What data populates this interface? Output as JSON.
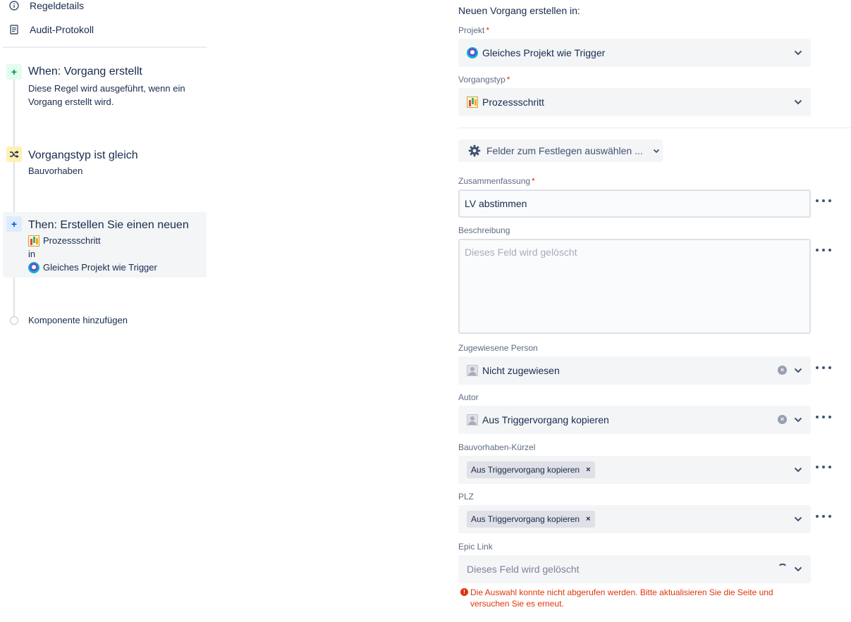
{
  "sidebar": {
    "nav": [
      {
        "label": "Regeldetails",
        "icon": "info-icon"
      },
      {
        "label": "Audit-Protokoll",
        "icon": "document-icon"
      }
    ],
    "steps": [
      {
        "badge": "+",
        "title": "When: Vorgang erstellt",
        "desc": "Diese Regel wird ausgeführt, wenn ein Vorgang erstellt wird."
      },
      {
        "title": "Vorgangstyp ist gleich",
        "desc": "Bauvorhaben"
      },
      {
        "badge": "+",
        "title": "Then: Erstellen Sie einen neuen",
        "issue_type": "Prozessschritt",
        "in": "in",
        "project": "Gleiches Projekt wie Trigger"
      }
    ],
    "add_component": "Komponente hinzufügen"
  },
  "form": {
    "heading": "Neuen Vorgang erstellen in:",
    "project": {
      "label": "Projekt",
      "required": "*",
      "value": "Gleiches Projekt wie Trigger"
    },
    "issue_type": {
      "label": "Vorgangstyp",
      "required": "*",
      "value": "Prozessschritt"
    },
    "fields_button": "Felder zum Festlegen auswählen ...",
    "summary": {
      "label": "Zusammenfassung",
      "required": "*",
      "value": "LV abstimmen"
    },
    "description": {
      "label": "Beschreibung",
      "placeholder": "Dieses Feld wird gelöscht"
    },
    "assignee": {
      "label": "Zugewiesene Person",
      "value": "Nicht zugewiesen",
      "clear": "×"
    },
    "reporter": {
      "label": "Autor",
      "value": "Aus Triggervorgang kopieren",
      "clear": "×"
    },
    "bauvorhaben_kuerzel": {
      "label": "Bauvorhaben-Kürzel",
      "tag": "Aus Triggervorgang kopieren",
      "tag_remove": "×"
    },
    "plz": {
      "label": "PLZ",
      "tag": "Aus Triggervorgang kopieren",
      "tag_remove": "×"
    },
    "epic_link": {
      "label": "Epic Link",
      "placeholder": "Dieses Feld wird gelöscht"
    },
    "error": {
      "icon": "!",
      "text": "Die Auswahl konnte nicht abgerufen werden. Bitte aktualisieren Sie die Seite und versuchen Sie es erneut."
    }
  },
  "colors": {
    "error": "#de350b",
    "required": "#de350b",
    "field_bg": "#f4f5f7",
    "text": "#172b4d",
    "label": "#5e6c84"
  }
}
